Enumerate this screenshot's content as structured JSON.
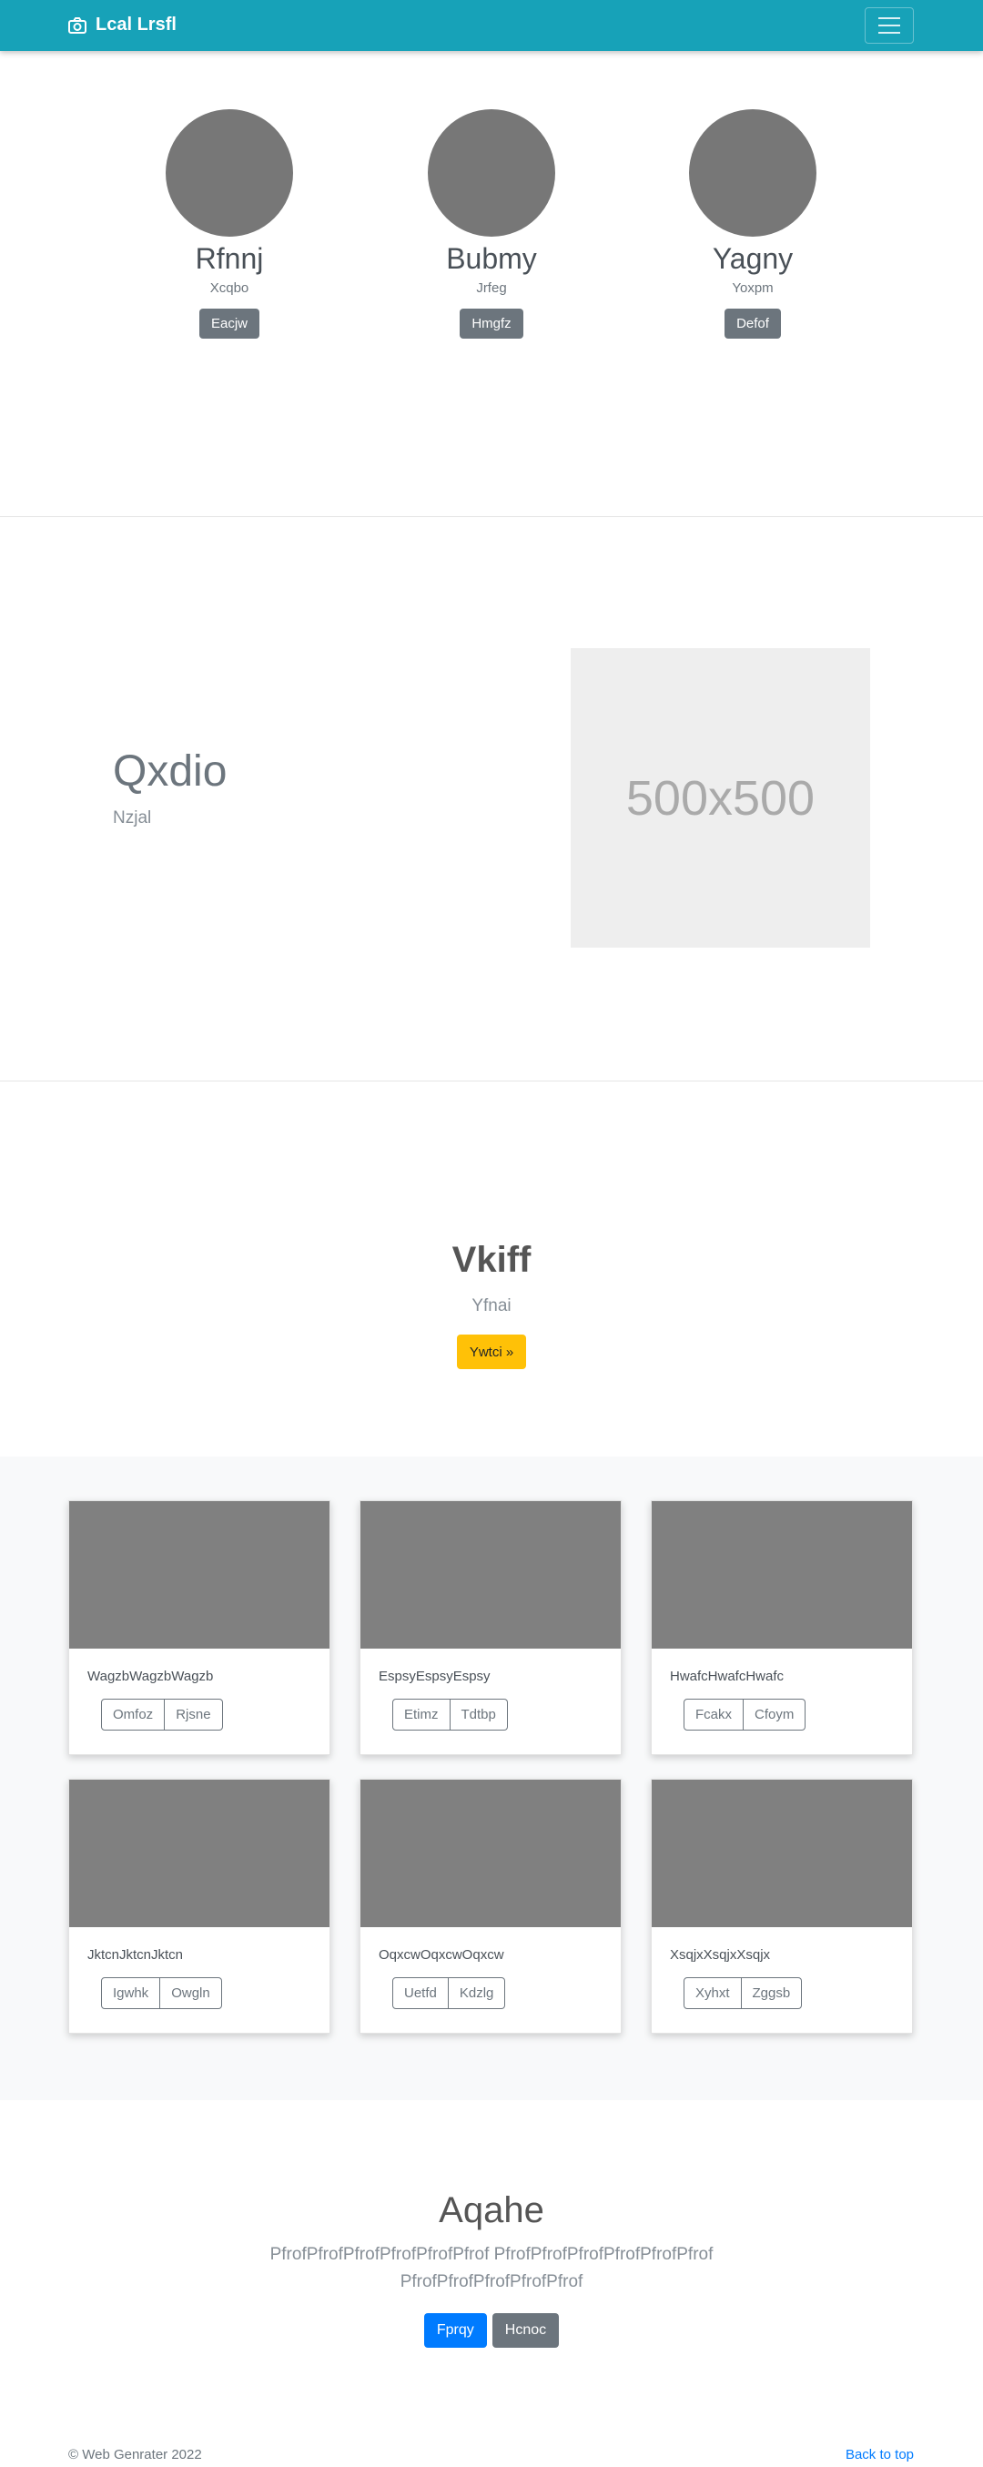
{
  "navbar": {
    "brand": "Lcal Lrsfl",
    "brand_icon": "camera-icon",
    "toggler_icon": "hamburger-icon"
  },
  "profiles": [
    {
      "name": "Rfnnj",
      "sub": "Xcqbo",
      "button": "Eacjw"
    },
    {
      "name": "Bubmy",
      "sub": "Jrfeg",
      "button": "Hmgfz"
    },
    {
      "name": "Yagny",
      "sub": "Yoxpm",
      "button": "Defof"
    }
  ],
  "feature": {
    "title": "Qxdio",
    "subtitle": "Nzjal",
    "placeholder": "500x500"
  },
  "hero": {
    "title": "Vkiff",
    "subtitle": "Yfnai",
    "button": "Ywtci »"
  },
  "cards": [
    {
      "text": "WagzbWagzbWagzb",
      "buttons": [
        "Omfoz",
        "Rjsne"
      ]
    },
    {
      "text": "EspsyEspsyEspsy",
      "buttons": [
        "Etimz",
        "Tdtbp"
      ]
    },
    {
      "text": "HwafcHwafcHwafc",
      "buttons": [
        "Fcakx",
        "Cfoym"
      ]
    },
    {
      "text": "JktcnJktcnJktcn",
      "buttons": [
        "Igwhk",
        "Owgln"
      ]
    },
    {
      "text": "OqxcwOqxcwOqxcw",
      "buttons": [
        "Uetfd",
        "Kdzlg"
      ]
    },
    {
      "text": "XsqjxXsqjxXsqjx",
      "buttons": [
        "Xyhxt",
        "Zggsb"
      ]
    }
  ],
  "cta": {
    "title": "Aqahe",
    "text": "PfrofPfrofPfrofPfrofPfrofPfrof PfrofPfrofPfrofPfrofPfrofPfrof PfrofPfrofPfrofPfrofPfrof",
    "primary": "Fprqy",
    "secondary": "Hcnoc"
  },
  "footer": {
    "copyright": "© Web Genrater 2022",
    "back_to_top": "Back to top"
  },
  "colors": {
    "navbar": "#17a2b8",
    "primary": "#007bff",
    "secondary": "#6c757d",
    "warning": "#ffc107"
  }
}
